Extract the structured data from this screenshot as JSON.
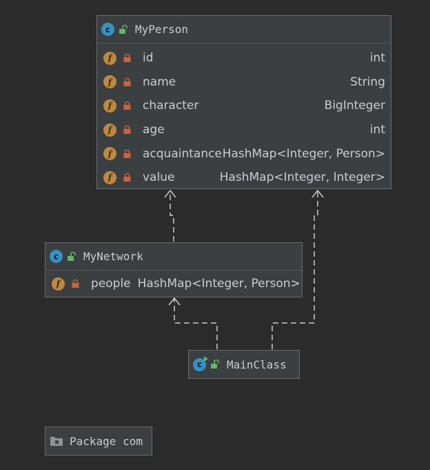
{
  "classes": {
    "myperson": {
      "name": "MyPerson",
      "fields": [
        {
          "name": "id",
          "type": "int"
        },
        {
          "name": "name",
          "type": "String"
        },
        {
          "name": "character",
          "type": "BigInteger"
        },
        {
          "name": "age",
          "type": "int"
        },
        {
          "name": "acquaintance",
          "type": "HashMap<Integer, Person>"
        },
        {
          "name": "value",
          "type": "HashMap<Integer, Integer>"
        }
      ]
    },
    "mynetwork": {
      "name": "MyNetwork",
      "fields": [
        {
          "name": "people",
          "type": "HashMap<Integer, Person>"
        }
      ]
    },
    "mainclass": {
      "name": "MainClass"
    }
  },
  "package": {
    "label": "Package com"
  },
  "icons": {
    "class": "class-icon",
    "field": "field-icon",
    "private": "lock-icon",
    "public": "unlock-icon",
    "package": "folder-icon"
  },
  "colors": {
    "background": "#2b2b2b",
    "node": "#3c3f41",
    "class_icon": "#3592c4",
    "field_icon": "#c0883b",
    "lock": "#d0623a",
    "public": "#5fb85f"
  }
}
